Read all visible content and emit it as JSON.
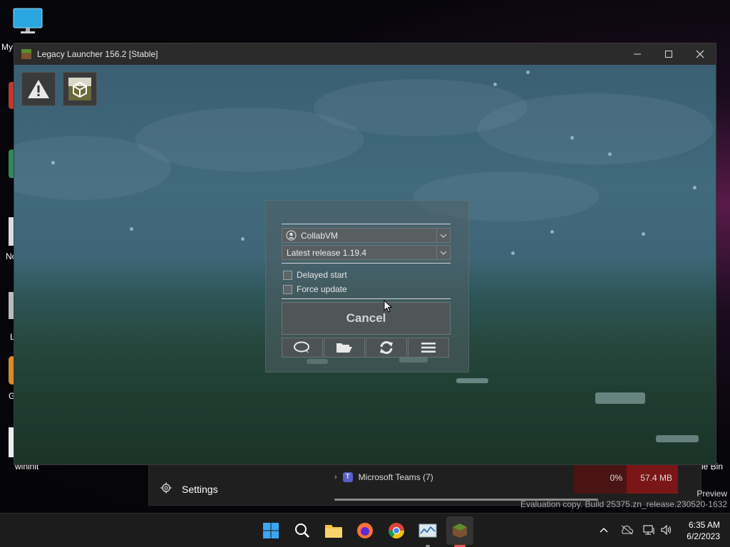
{
  "desktop": {
    "icons": [
      {
        "label": "My"
      },
      {
        "label": "Nc"
      },
      {
        "label": "L"
      },
      {
        "label": "G"
      }
    ],
    "bottom_left_label": "wininit",
    "bottom_right_label": "le Bin"
  },
  "background_window": {
    "settings_label": "Settings",
    "teams_label": "Microsoft Teams (7)",
    "cpu": "0%",
    "memory": "57.4 MB"
  },
  "watermark": {
    "line1": "Preview",
    "line2": "Evaluation copy. Build 25375.zn_release.230520-1632"
  },
  "launcher": {
    "title": "Legacy Launcher 156.2 [Stable]",
    "account": "CollabVM",
    "version": "Latest release 1.19.4",
    "delayed_start": "Delayed start",
    "force_update": "Force update",
    "cancel": "Cancel"
  },
  "taskbar": {
    "time": "6:35 AM",
    "date": "6/2/2023"
  },
  "colors": {
    "scene_top": "#3a5f74",
    "scene_bottom": "#1a3329",
    "mem_highlight": "#7a1616"
  }
}
